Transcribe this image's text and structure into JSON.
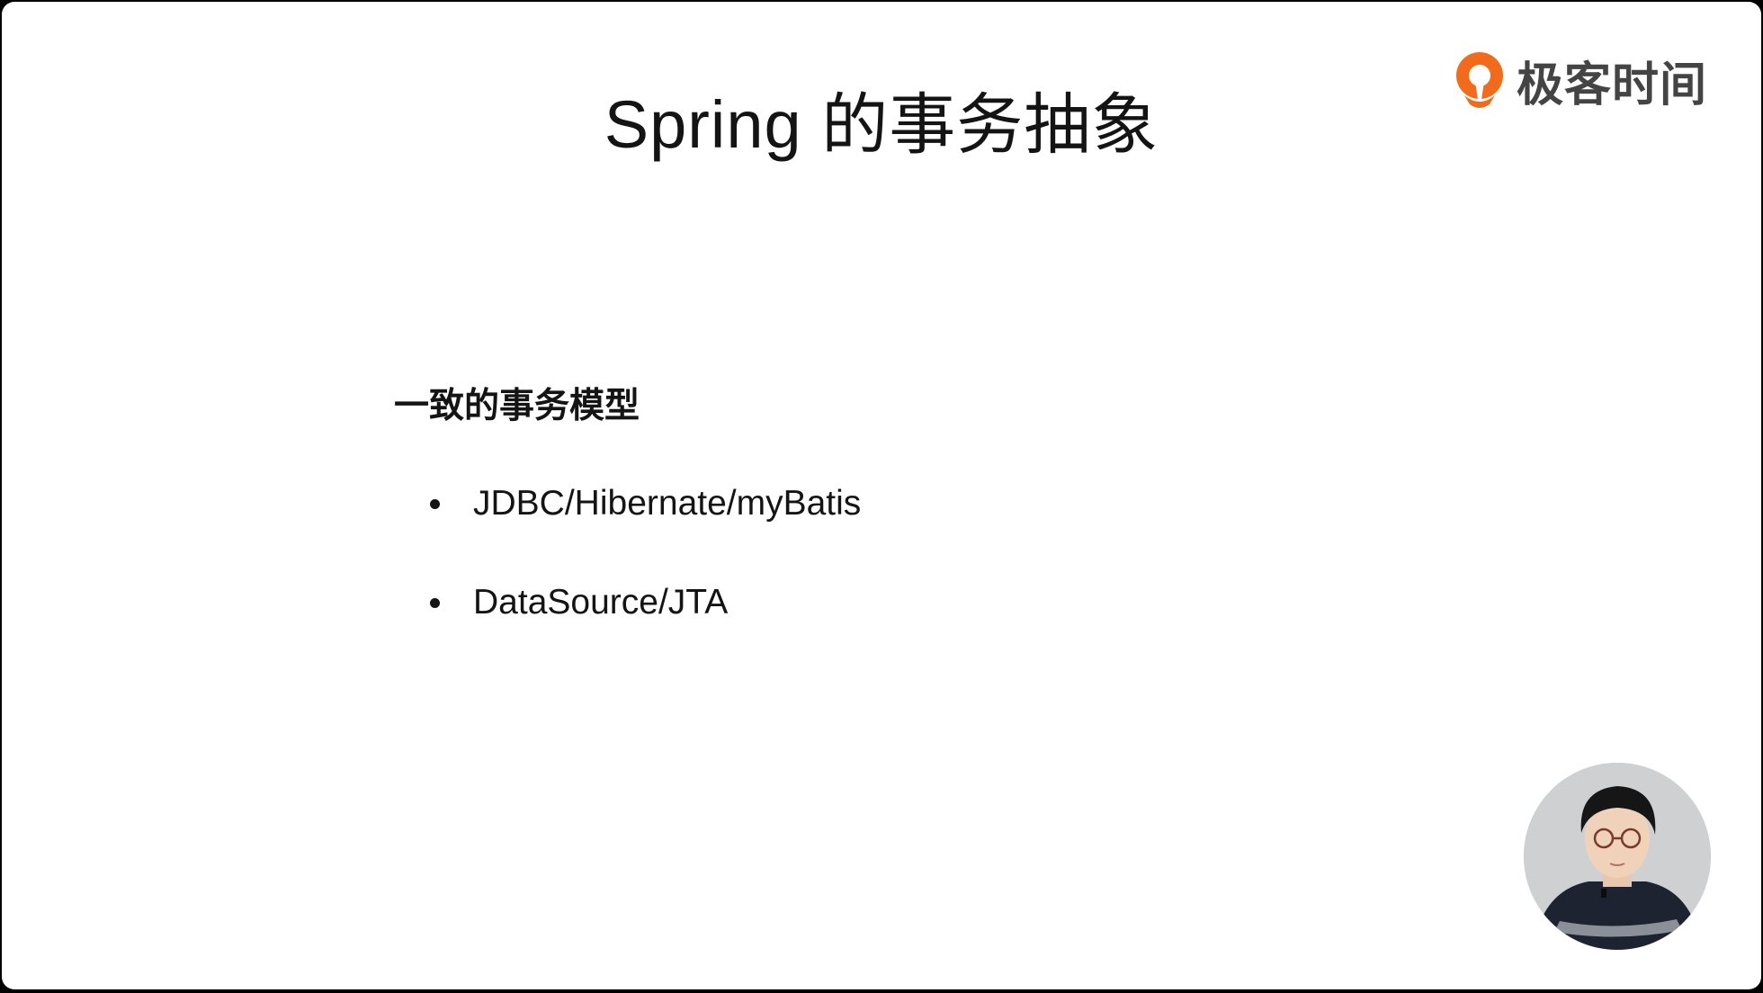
{
  "slide": {
    "title": "Spring 的事务抽象",
    "heading": "一致的事务模型",
    "bullets": [
      "JDBC/Hibernate/myBatis",
      "DataSource/JTA"
    ]
  },
  "brand": {
    "logo_text": "极客时间",
    "logo_icon": "geektime-logo-icon",
    "accent_color": "#f26a1b"
  },
  "presenter": {
    "icon": "presenter-avatar"
  }
}
